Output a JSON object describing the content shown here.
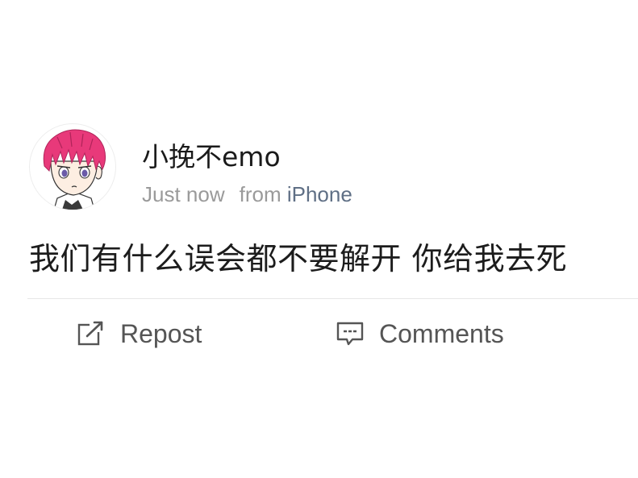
{
  "post": {
    "author": {
      "name": "小挽不emo",
      "avatar": "anime-boy-pink-hair-avatar"
    },
    "meta": {
      "time": "Just now",
      "from_label": "from",
      "source": "iPhone"
    },
    "text": "我们有什么误会都不要解开 你给我去死",
    "actions": {
      "repost": {
        "label": "Repost",
        "icon": "repost-icon"
      },
      "comments": {
        "label": "Comments",
        "icon": "comment-icon"
      }
    }
  },
  "colors": {
    "text_primary": "#1a1a1a",
    "text_secondary": "#9a9a9a",
    "source_link": "#5f6f85",
    "action_text": "#555555",
    "hair_pink": "#e8397a",
    "divider": "#e6e6e6"
  }
}
